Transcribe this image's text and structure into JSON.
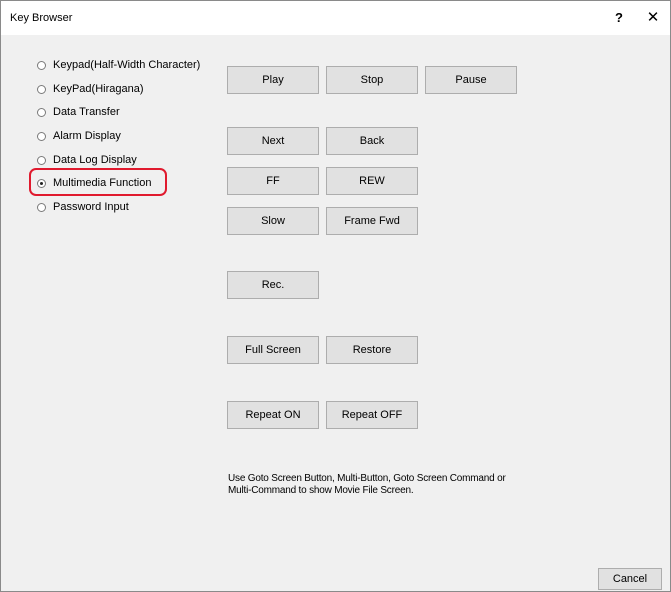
{
  "window": {
    "title": "Key Browser",
    "help_label": "?",
    "close_label": "✕"
  },
  "radios": [
    {
      "label": "Keypad(Half-Width Character)",
      "selected": false
    },
    {
      "label": "KeyPad(Hiragana)",
      "selected": false
    },
    {
      "label": "Data Transfer",
      "selected": false
    },
    {
      "label": "Alarm Display",
      "selected": false
    },
    {
      "label": "Data Log Display",
      "selected": false
    },
    {
      "label": "Multimedia Function",
      "selected": true
    },
    {
      "label": "Password Input",
      "selected": false
    }
  ],
  "buttons": {
    "play": "Play",
    "stop": "Stop",
    "pause": "Pause",
    "next": "Next",
    "back": "Back",
    "ff": "FF",
    "rew": "REW",
    "slow": "Slow",
    "frame_fwd": "Frame Fwd",
    "rec": "Rec.",
    "full_screen": "Full Screen",
    "restore": "Restore",
    "repeat_on": "Repeat ON",
    "repeat_off": "Repeat OFF"
  },
  "info": {
    "line1": "Use Goto Screen Button, Multi-Button, Goto Screen Command or",
    "line2": "Multi-Command to show Movie File Screen."
  },
  "footer": {
    "cancel_label": "Cancel"
  },
  "colors": {
    "highlight": "#e01a2e",
    "button_bg": "#e1e1e1",
    "dialog_bg": "#f0f0f0"
  }
}
